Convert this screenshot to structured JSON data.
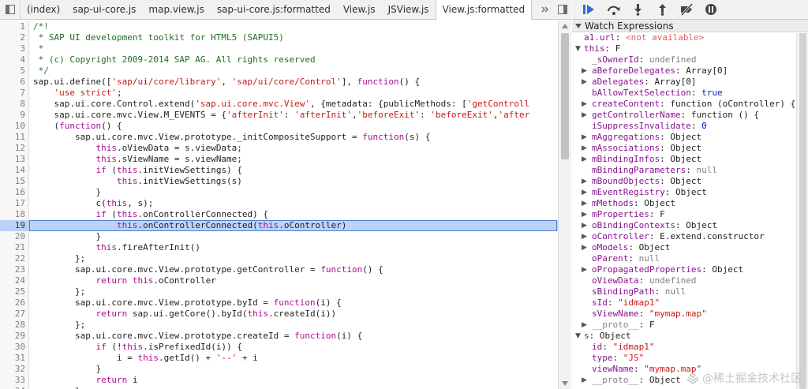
{
  "tabs": [
    "(index)",
    "sap-ui-core.js",
    "map.view.js",
    "sap-ui-core.js:formatted",
    "View.js",
    "JSView.js",
    "View.js:formatted"
  ],
  "active_tab": 6,
  "highlighted_line": 19,
  "source_lines": [
    {
      "n": "1",
      "t": "/*!"
    },
    {
      "n": "2",
      "t": " * SAP UI development toolkit for HTML5 (SAPUI5)"
    },
    {
      "n": "3",
      "t": " *"
    },
    {
      "n": "4",
      "t": " * (c) Copyright 2009-2014 SAP AG. All rights reserved"
    },
    {
      "n": "5",
      "t": " */"
    },
    {
      "n": "6",
      "t": "sap.ui.define(['sap/ui/core/library', 'sap/ui/core/Control'], function() {"
    },
    {
      "n": "7",
      "t": "    'use strict';"
    },
    {
      "n": "8",
      "t": "    sap.ui.core.Control.extend('sap.ui.core.mvc.View', {metadata: {publicMethods: ['getControll"
    },
    {
      "n": "9",
      "t": "    sap.ui.core.mvc.View.M_EVENTS = {'afterInit': 'afterInit','beforeExit': 'beforeExit','after"
    },
    {
      "n": "10",
      "t": "    (function() {"
    },
    {
      "n": "11",
      "t": "        sap.ui.core.mvc.View.prototype._initCompositeSupport = function(s) {"
    },
    {
      "n": "12",
      "t": "            this.oViewData = s.viewData;"
    },
    {
      "n": "13",
      "t": "            this.sViewName = s.viewName;"
    },
    {
      "n": "14",
      "t": "            if (this.initViewSettings) {"
    },
    {
      "n": "15",
      "t": "                this.initViewSettings(s)"
    },
    {
      "n": "16",
      "t": "            }"
    },
    {
      "n": "17",
      "t": "            c(this, s);"
    },
    {
      "n": "18",
      "t": "            if (this.onControllerConnected) {"
    },
    {
      "n": "19",
      "t": "                this.onControllerConnected(this.oController)"
    },
    {
      "n": "20",
      "t": "            }"
    },
    {
      "n": "21",
      "t": "            this.fireAfterInit()"
    },
    {
      "n": "22",
      "t": "        };"
    },
    {
      "n": "23",
      "t": "        sap.ui.core.mvc.View.prototype.getController = function() {"
    },
    {
      "n": "24",
      "t": "            return this.oController"
    },
    {
      "n": "25",
      "t": "        };"
    },
    {
      "n": "26",
      "t": "        sap.ui.core.mvc.View.prototype.byId = function(i) {"
    },
    {
      "n": "27",
      "t": "            return sap.ui.getCore().byId(this.createId(i))"
    },
    {
      "n": "28",
      "t": "        };"
    },
    {
      "n": "29",
      "t": "        sap.ui.core.mvc.View.prototype.createId = function(i) {"
    },
    {
      "n": "30",
      "t": "            if (!this.isPrefixedId(i)) {"
    },
    {
      "n": "31",
      "t": "                i = this.getId() + '--' + i"
    },
    {
      "n": "32",
      "t": "            }"
    },
    {
      "n": "33",
      "t": "            return i"
    },
    {
      "n": "34",
      "t": "        }"
    }
  ],
  "watch": {
    "title": "Watch Expressions",
    "rows": [
      {
        "indent": 0,
        "arrow": "",
        "key": "a1.url",
        "val": "<not available>",
        "vtype": "err",
        "keytype": "err"
      },
      {
        "indent": 0,
        "arrow": "down",
        "key": "this",
        "val": "F",
        "vtype": "obj"
      },
      {
        "indent": 1,
        "arrow": "",
        "key": "_sOwnerId",
        "val": "undefined",
        "vtype": "gray"
      },
      {
        "indent": 1,
        "arrow": "right",
        "key": "aBeforeDelegates",
        "val": "Array[0]",
        "vtype": "obj"
      },
      {
        "indent": 1,
        "arrow": "right",
        "key": "aDelegates",
        "val": "Array[0]",
        "vtype": "obj"
      },
      {
        "indent": 1,
        "arrow": "",
        "key": "bAllowTextSelection",
        "val": "true",
        "vtype": "kw"
      },
      {
        "indent": 1,
        "arrow": "right",
        "key": "createContent",
        "val": "function (oController) {",
        "vtype": "obj"
      },
      {
        "indent": 1,
        "arrow": "right",
        "key": "getControllerName",
        "val": "function () {",
        "vtype": "obj"
      },
      {
        "indent": 1,
        "arrow": "",
        "key": "iSuppressInvalidate",
        "val": "0",
        "vtype": "num"
      },
      {
        "indent": 1,
        "arrow": "right",
        "key": "mAggregations",
        "val": "Object",
        "vtype": "obj"
      },
      {
        "indent": 1,
        "arrow": "right",
        "key": "mAssociations",
        "val": "Object",
        "vtype": "obj"
      },
      {
        "indent": 1,
        "arrow": "right",
        "key": "mBindingInfos",
        "val": "Object",
        "vtype": "obj"
      },
      {
        "indent": 1,
        "arrow": "",
        "key": "mBindingParameters",
        "val": "null",
        "vtype": "gray"
      },
      {
        "indent": 1,
        "arrow": "right",
        "key": "mBoundObjects",
        "val": "Object",
        "vtype": "obj"
      },
      {
        "indent": 1,
        "arrow": "right",
        "key": "mEventRegistry",
        "val": "Object",
        "vtype": "obj"
      },
      {
        "indent": 1,
        "arrow": "right",
        "key": "mMethods",
        "val": "Object",
        "vtype": "obj"
      },
      {
        "indent": 1,
        "arrow": "right",
        "key": "mProperties",
        "val": "F",
        "vtype": "obj"
      },
      {
        "indent": 1,
        "arrow": "right",
        "key": "oBindingContexts",
        "val": "Object",
        "vtype": "obj"
      },
      {
        "indent": 1,
        "arrow": "right",
        "key": "oController",
        "val": "E.extend.constructor",
        "vtype": "obj"
      },
      {
        "indent": 1,
        "arrow": "right",
        "key": "oModels",
        "val": "Object",
        "vtype": "obj"
      },
      {
        "indent": 1,
        "arrow": "",
        "key": "oParent",
        "val": "null",
        "vtype": "gray"
      },
      {
        "indent": 1,
        "arrow": "right",
        "key": "oPropagatedProperties",
        "val": "Object",
        "vtype": "obj"
      },
      {
        "indent": 1,
        "arrow": "",
        "key": "oViewData",
        "val": "undefined",
        "vtype": "gray"
      },
      {
        "indent": 1,
        "arrow": "",
        "key": "sBindingPath",
        "val": "null",
        "vtype": "gray"
      },
      {
        "indent": 1,
        "arrow": "",
        "key": "sId",
        "val": "\"idmap1\"",
        "vtype": "str"
      },
      {
        "indent": 1,
        "arrow": "",
        "key": "sViewName",
        "val": "\"mymap.map\"",
        "vtype": "str"
      },
      {
        "indent": 1,
        "arrow": "right",
        "key": "__proto__",
        "val": "F",
        "vtype": "obj",
        "keytype": "grey"
      },
      {
        "indent": 0,
        "arrow": "down",
        "key": "s",
        "val": "Object",
        "vtype": "obj"
      },
      {
        "indent": 1,
        "arrow": "",
        "key": "id",
        "val": "\"idmap1\"",
        "vtype": "str"
      },
      {
        "indent": 1,
        "arrow": "",
        "key": "type",
        "val": "\"JS\"",
        "vtype": "str"
      },
      {
        "indent": 1,
        "arrow": "",
        "key": "viewName",
        "val": "\"mymap.map\"",
        "vtype": "str"
      },
      {
        "indent": 1,
        "arrow": "right",
        "key": "__proto__",
        "val": "Object",
        "vtype": "obj",
        "keytype": "grey"
      }
    ]
  },
  "watermark": "@稀土掘金技术社区",
  "colors": {
    "highlight": "#bcd3f7",
    "accent": "#2b6fd6"
  }
}
